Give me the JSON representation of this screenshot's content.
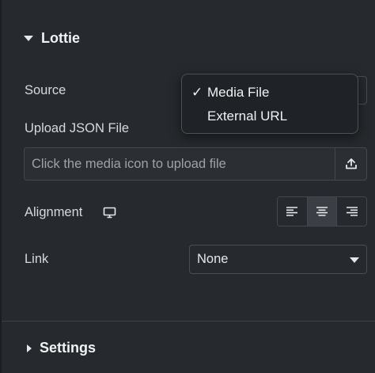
{
  "lottie_section": {
    "title": "Lottie",
    "expanded": true
  },
  "source": {
    "label": "Source",
    "options": [
      {
        "label": "Media File",
        "checked": true
      },
      {
        "label": "External URL",
        "checked": false
      }
    ],
    "check_glyph": "✓"
  },
  "upload": {
    "label": "Upload JSON File",
    "placeholder": "Click the media icon to upload file",
    "icon": "upload-icon"
  },
  "alignment": {
    "label": "Alignment",
    "device_icon": "desktop-icon",
    "options": [
      "align-left",
      "align-center",
      "align-right"
    ],
    "selected": "align-center"
  },
  "link": {
    "label": "Link",
    "value": "None"
  },
  "settings_section": {
    "title": "Settings",
    "expanded": false
  }
}
